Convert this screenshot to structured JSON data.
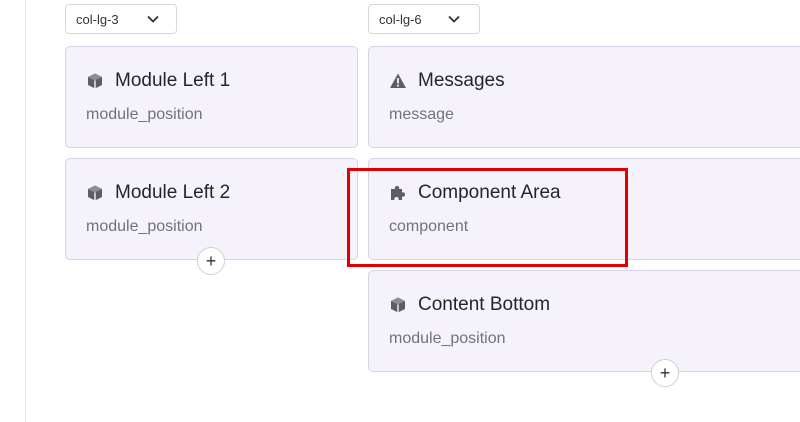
{
  "columns": {
    "left": {
      "size_label": "col-lg-3"
    },
    "center": {
      "size_label": "col-lg-6"
    }
  },
  "modules": {
    "left1": {
      "title": "Module Left 1",
      "position": "module_position",
      "icon": "cube-icon"
    },
    "left2": {
      "title": "Module Left 2",
      "position": "module_position",
      "icon": "cube-icon"
    },
    "messages": {
      "title": "Messages",
      "position": "message",
      "icon": "warning-icon"
    },
    "component": {
      "title": "Component Area",
      "position": "component",
      "icon": "puzzle-icon"
    },
    "bottom": {
      "title": "Content Bottom",
      "position": "module_position",
      "icon": "cube-icon"
    }
  },
  "add_label": "+",
  "colors": {
    "card_bg": "#f5f2fb",
    "card_border": "#d7d3e6",
    "highlight": "#e00000"
  }
}
